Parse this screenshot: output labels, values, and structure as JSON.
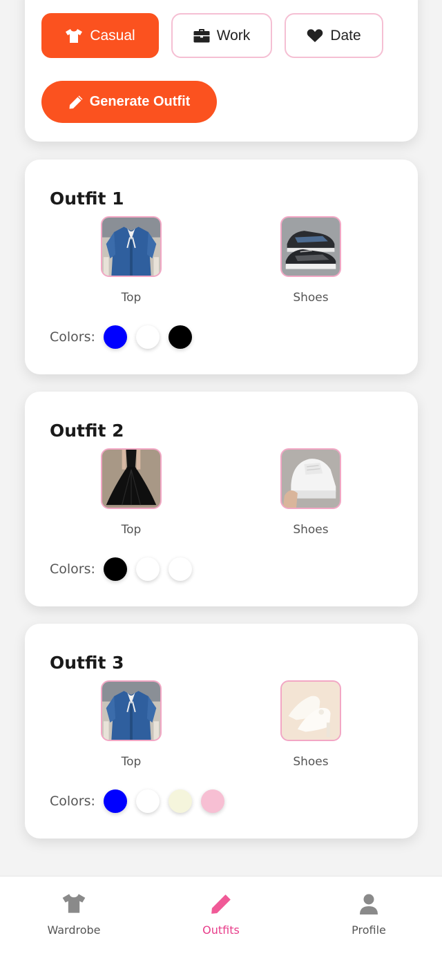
{
  "occasions": [
    {
      "label": "Casual",
      "icon": "tshirt-icon",
      "active": true
    },
    {
      "label": "Work",
      "icon": "briefcase-icon",
      "active": false
    },
    {
      "label": "Date",
      "icon": "heart-icon",
      "active": false
    }
  ],
  "generate_button": {
    "label": "Generate Outfit",
    "icon": "pencil-icon"
  },
  "outfits": [
    {
      "title": "Outfit 1",
      "items": [
        {
          "label": "Top",
          "image": "denim-top-photo"
        },
        {
          "label": "Shoes",
          "image": "black-sneakers-photo"
        }
      ],
      "colors_label": "Colors:",
      "colors": [
        "#0000ff",
        "#ffffff",
        "#000000"
      ]
    },
    {
      "title": "Outfit 2",
      "items": [
        {
          "label": "Top",
          "image": "black-dress-photo"
        },
        {
          "label": "Shoes",
          "image": "white-sneakers-photo"
        }
      ],
      "colors_label": "Colors:",
      "colors": [
        "#000000",
        "#ffffff",
        "#ffffff"
      ]
    },
    {
      "title": "Outfit 3",
      "items": [
        {
          "label": "Top",
          "image": "denim-top-photo"
        },
        {
          "label": "Shoes",
          "image": "white-heels-photo"
        }
      ],
      "colors_label": "Colors:",
      "colors": [
        "#0000ff",
        "#ffffff",
        "#f5f5dc",
        "#f7bfd3"
      ]
    }
  ],
  "nav": {
    "items": [
      {
        "label": "Wardrobe",
        "icon": "tshirt-icon",
        "active": false
      },
      {
        "label": "Outfits",
        "icon": "pencil-icon",
        "active": true
      },
      {
        "label": "Profile",
        "icon": "user-icon",
        "active": false
      }
    ]
  },
  "colors": {
    "accent": "#fb521f",
    "pink_border": "#f5bfd3",
    "nav_active": "#e83d8a",
    "nav_inactive": "#8a8a8a"
  }
}
